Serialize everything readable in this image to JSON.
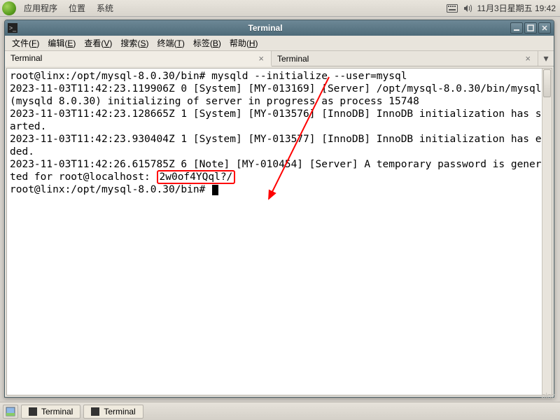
{
  "top_panel": {
    "menus": [
      "应用程序",
      "位置",
      "系统"
    ],
    "clock": "11月3日星期五 19:42"
  },
  "window": {
    "title": "Terminal"
  },
  "menubar": {
    "items": [
      {
        "label": "文件",
        "accel": "F"
      },
      {
        "label": "编辑",
        "accel": "E"
      },
      {
        "label": "查看",
        "accel": "V"
      },
      {
        "label": "搜索",
        "accel": "S"
      },
      {
        "label": "终端",
        "accel": "T"
      },
      {
        "label": "标签",
        "accel": "B"
      },
      {
        "label": "帮助",
        "accel": "H"
      }
    ]
  },
  "tabs": {
    "items": [
      "Terminal",
      "Terminal"
    ],
    "active_index": 0
  },
  "terminal": {
    "prompt1": "root@linx:/opt/mysql-8.0.30/bin# ",
    "cmd1": "mysqld --initialize --user=mysql",
    "lines": [
      "2023-11-03T11:42:23.119906Z 0 [System] [MY-013169] [Server] /opt/mysql-8.0.30/bin/mysqld (mysqld 8.0.30) initializing of server in progress as process 15748",
      "2023-11-03T11:42:23.128665Z 1 [System] [MY-013576] [InnoDB] InnoDB initialization has started.",
      "2023-11-03T11:42:23.930404Z 1 [System] [MY-013577] [InnoDB] InnoDB initialization has ended.",
      "2023-11-03T11:42:26.615785Z 6 [Note] [MY-010454] [Server] A temporary password is generated for root@localhost: "
    ],
    "password": "2w0of4YQql?/",
    "prompt2": "root@linx:/opt/mysql-8.0.30/bin# "
  },
  "taskbar": {
    "items": [
      "Terminal",
      "Terminal"
    ]
  },
  "watermark": "blog"
}
